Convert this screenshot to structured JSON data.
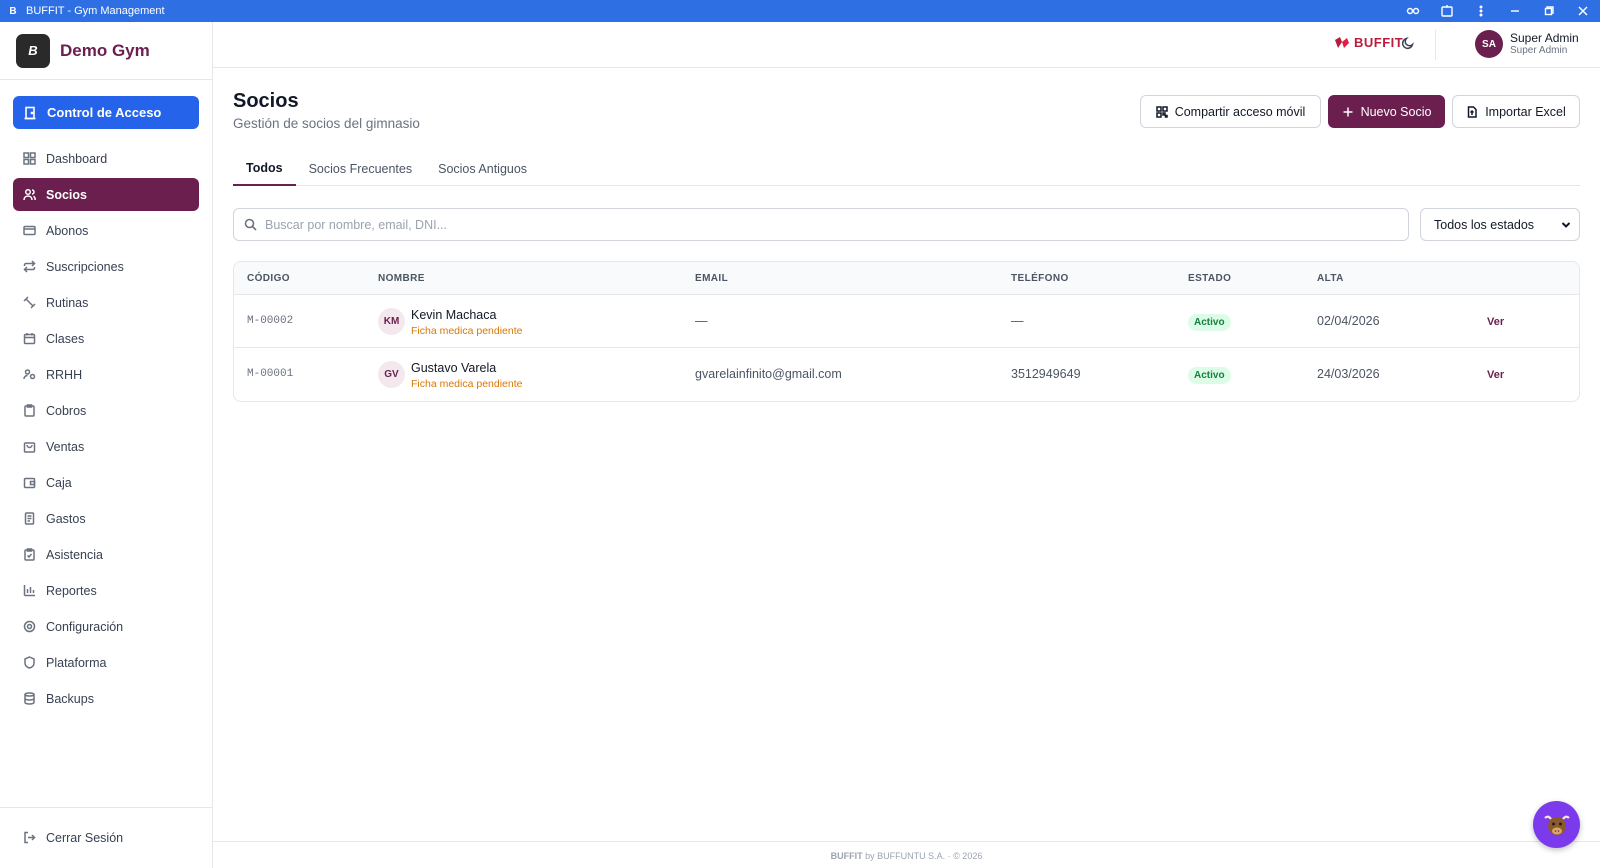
{
  "window": {
    "title": "BUFFIT - Gym Management",
    "icon_letter": "B"
  },
  "brand": {
    "name": "Demo Gym",
    "logo_text": "B"
  },
  "sidebar": {
    "access_button": "Control de Acceso",
    "items": [
      {
        "label": "Dashboard",
        "icon": "dashboard-icon"
      },
      {
        "label": "Socios",
        "icon": "users-icon",
        "active": true
      },
      {
        "label": "Abonos",
        "icon": "card-icon"
      },
      {
        "label": "Suscripciones",
        "icon": "repeat-icon"
      },
      {
        "label": "Rutinas",
        "icon": "dumbbell-icon"
      },
      {
        "label": "Clases",
        "icon": "calendar-icon"
      },
      {
        "label": "RRHH",
        "icon": "user-group-icon"
      },
      {
        "label": "Cobros",
        "icon": "clipboard-icon"
      },
      {
        "label": "Ventas",
        "icon": "bag-icon"
      },
      {
        "label": "Caja",
        "icon": "wallet-icon"
      },
      {
        "label": "Gastos",
        "icon": "receipt-icon"
      },
      {
        "label": "Asistencia",
        "icon": "clipboard-check-icon"
      },
      {
        "label": "Reportes",
        "icon": "bar-chart-icon"
      },
      {
        "label": "Configuración",
        "icon": "gear-icon"
      },
      {
        "label": "Plataforma",
        "icon": "shield-icon"
      },
      {
        "label": "Backups",
        "icon": "database-icon"
      }
    ],
    "logout": "Cerrar Sesión"
  },
  "header": {
    "logo": "BUFFIT",
    "user": {
      "initials": "SA",
      "name": "Super Admin",
      "role": "Super Admin"
    }
  },
  "page": {
    "title": "Socios",
    "subtitle": "Gestión de socios del gimnasio",
    "buttons": {
      "share": "Compartir acceso móvil",
      "new": "Nuevo Socio",
      "import": "Importar Excel"
    },
    "tabs": [
      "Todos",
      "Socios Frecuentes",
      "Socios Antiguos"
    ],
    "active_tab": "Todos",
    "search": {
      "placeholder": "Buscar por nombre, email, DNI...",
      "value": ""
    },
    "filter": {
      "selected": "Todos los estados"
    }
  },
  "table": {
    "columns": [
      "CÓDIGO",
      "NOMBRE",
      "EMAIL",
      "TELÉFONO",
      "ESTADO",
      "ALTA"
    ],
    "rows": [
      {
        "code": "M-00002",
        "initials": "KM",
        "name": "Kevin Machaca",
        "note": "Ficha medica pendiente",
        "email": "—",
        "phone": "—",
        "status": "Activo",
        "date": "02/04/2026",
        "action": "Ver"
      },
      {
        "code": "M-00001",
        "initials": "GV",
        "name": "Gustavo Varela",
        "note": "Ficha medica pendiente",
        "email": "gvarelainfinito@gmail.com",
        "phone": "3512949649",
        "status": "Activo",
        "date": "24/03/2026",
        "action": "Ver"
      }
    ]
  },
  "footer": {
    "brand": "BUFFIT",
    "text": "by BUFFUNTU S.A. · © 2026"
  },
  "colors": {
    "primary": "#6b1f4e",
    "accent_blue": "#2563eb",
    "titlebar": "#2f6fe4",
    "success_bg": "#dcfce7",
    "success_text": "#15803d",
    "warning": "#d97706"
  }
}
